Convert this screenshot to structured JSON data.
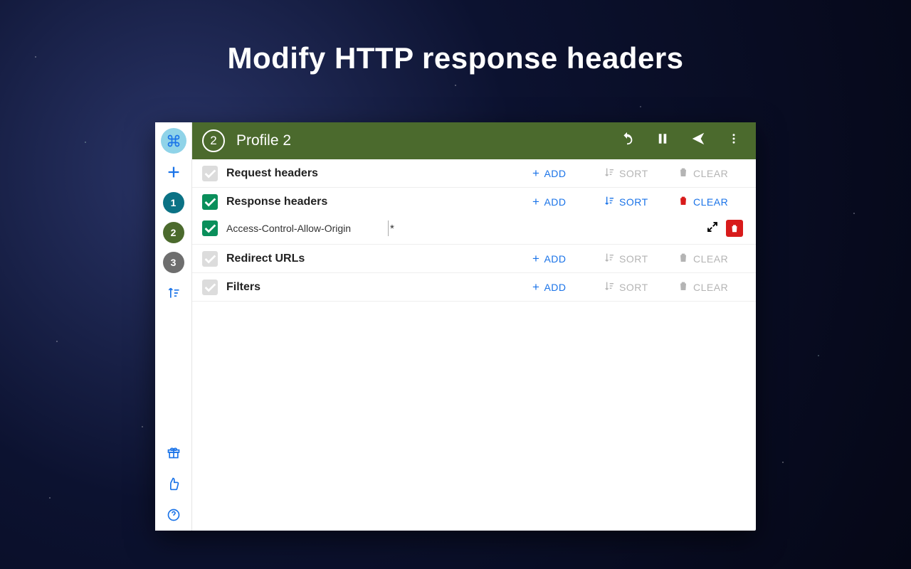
{
  "page_title": "Modify HTTP response headers",
  "sidebar": {
    "profile_numbers": [
      "1",
      "2",
      "3"
    ]
  },
  "header": {
    "profile_number": "2",
    "profile_name": "Profile 2"
  },
  "actions": {
    "add": "ADD",
    "sort": "SORT",
    "clear": "CLEAR"
  },
  "sections": [
    {
      "key": "request",
      "title": "Request headers",
      "checked": false,
      "add_enabled": true,
      "sort_enabled": false,
      "clear_enabled": false
    },
    {
      "key": "response",
      "title": "Response headers",
      "checked": true,
      "add_enabled": true,
      "sort_enabled": true,
      "clear_enabled": true
    },
    {
      "key": "redirect",
      "title": "Redirect URLs",
      "checked": false,
      "add_enabled": true,
      "sort_enabled": false,
      "clear_enabled": false
    },
    {
      "key": "filters",
      "title": "Filters",
      "checked": false,
      "add_enabled": true,
      "sort_enabled": false,
      "clear_enabled": false
    }
  ],
  "response_item": {
    "checked": true,
    "name": "Access-Control-Allow-Origin",
    "value": "*"
  }
}
